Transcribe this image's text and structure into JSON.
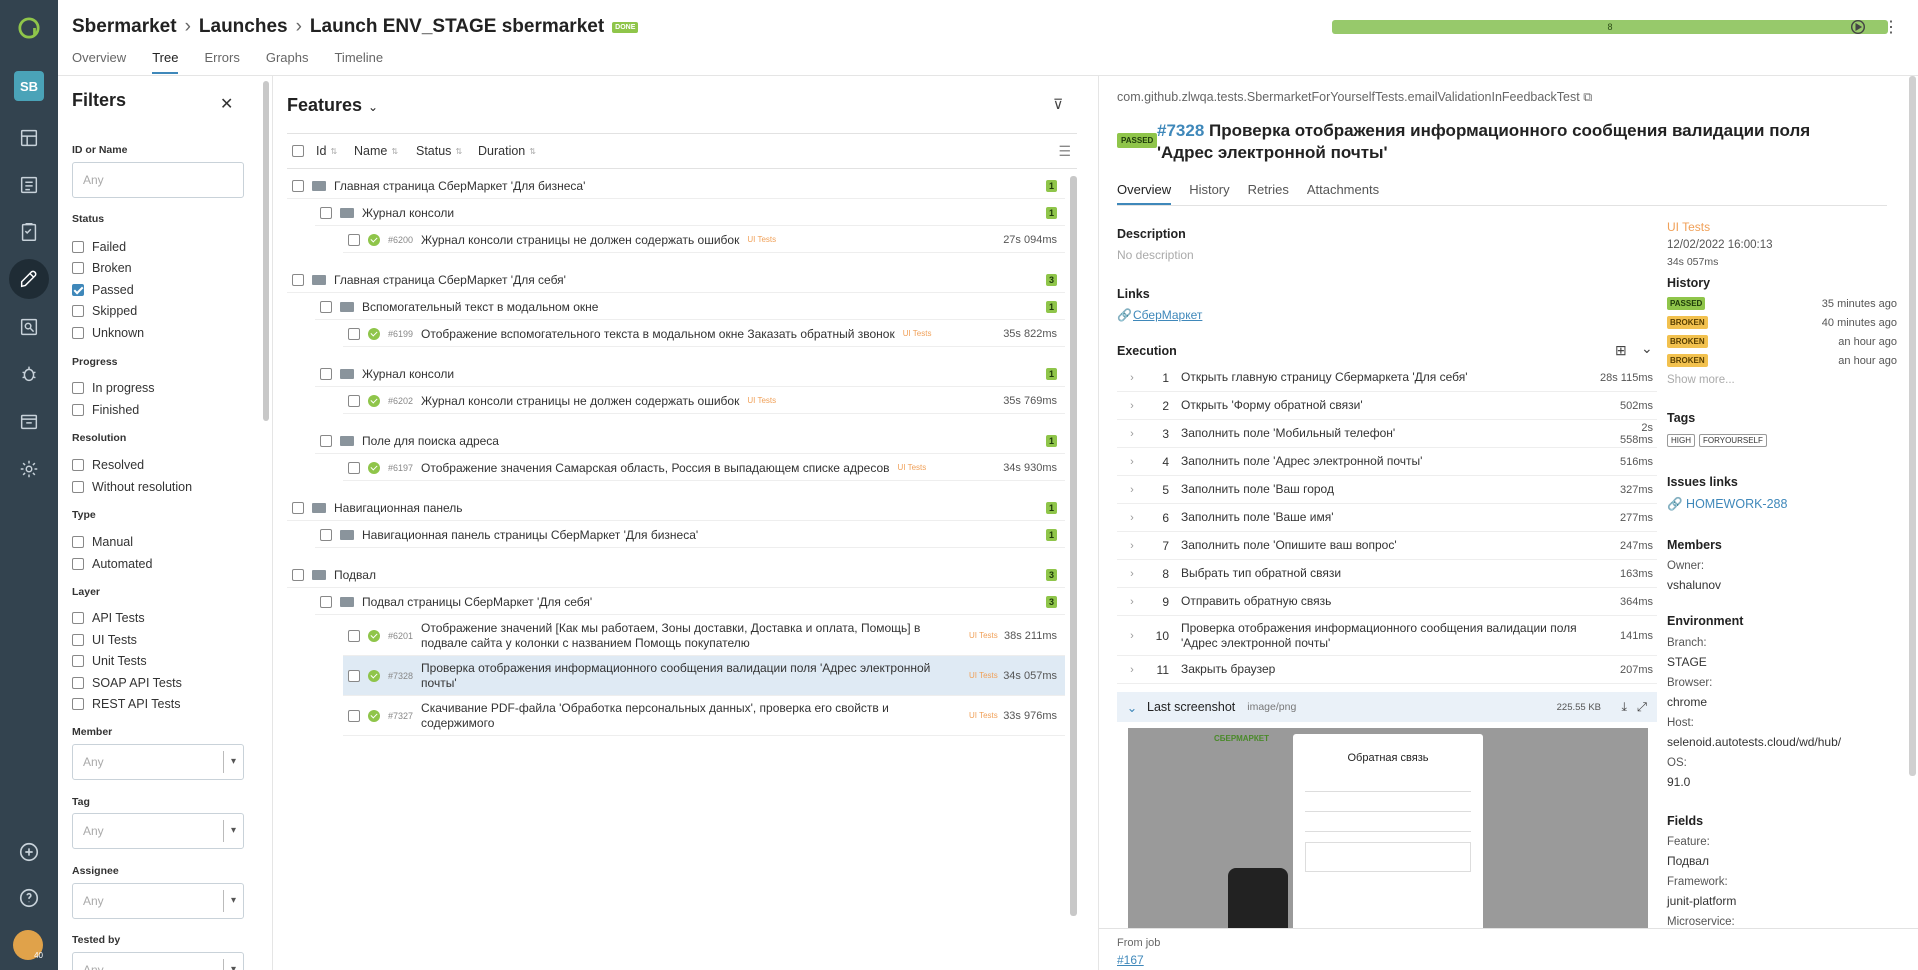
{
  "breadcrumb": {
    "project": "Sbermarket",
    "launches": "Launches",
    "launch": "Launch ENV_STAGE sbermarket",
    "status_badge": "DONE"
  },
  "top_tabs": [
    "Overview",
    "Tree",
    "Errors",
    "Graphs",
    "Timeline"
  ],
  "progress": {
    "label": "8",
    "fraction": 1.0,
    "color": "#97c96b"
  },
  "nav": {
    "avatar": "SB",
    "user_badge": "40"
  },
  "filters": {
    "title": "Filters",
    "id_label": "ID or Name",
    "id_placeholder": "Any",
    "status_label": "Status",
    "status": [
      {
        "label": "Failed",
        "checked": false
      },
      {
        "label": "Broken",
        "checked": false
      },
      {
        "label": "Passed",
        "checked": true
      },
      {
        "label": "Skipped",
        "checked": false
      },
      {
        "label": "Unknown",
        "checked": false
      }
    ],
    "progress_label": "Progress",
    "progress": [
      "In progress",
      "Finished"
    ],
    "resolution_label": "Resolution",
    "resolution": [
      "Resolved",
      "Without resolution"
    ],
    "type_label": "Type",
    "type": [
      "Manual",
      "Automated"
    ],
    "layer_label": "Layer",
    "layer": [
      "API Tests",
      "UI Tests",
      "Unit Tests",
      "SOAP API Tests",
      "REST API Tests"
    ],
    "member_label": "Member",
    "tag_label": "Tag",
    "assignee_label": "Assignee",
    "testedby_label": "Tested by",
    "select_placeholder": "Any"
  },
  "features": {
    "title": "Features",
    "columns": [
      "Id",
      "Name",
      "Status",
      "Duration"
    ],
    "rows": [
      {
        "name": "Главная страница СберМаркет 'Для бизнеса'",
        "count": "1"
      },
      {
        "name": "Журнал консоли",
        "count": "1"
      },
      {
        "id": "#6200",
        "name": "Журнал консоли страницы не должен содержать ошибок",
        "tag": "UI Tests",
        "duration": "27s 094ms"
      },
      {
        "name": "Главная страница СберМаркет 'Для себя'",
        "count": "3"
      },
      {
        "name": "Вспомогательный текст в модальном окне",
        "count": "1"
      },
      {
        "id": "#6199",
        "name": "Отображение вспомогательного текста в модальном окне Заказать обратный звонок",
        "tag": "UI Tests",
        "duration": "35s 822ms"
      },
      {
        "name": "Журнал консоли",
        "count": "1"
      },
      {
        "id": "#6202",
        "name": "Журнал консоли страницы не должен содержать ошибок",
        "tag": "UI Tests",
        "duration": "35s 769ms"
      },
      {
        "name": "Поле для поиска адреса",
        "count": "1"
      },
      {
        "id": "#6197",
        "name": "Отображение значения Самарская область, Россия в выпадающем списке адресов",
        "tag": "UI Tests",
        "duration": "34s 930ms"
      },
      {
        "name": "Навигационная панель",
        "count": "1"
      },
      {
        "name": "Навигационная панель страницы СберМаркет 'Для бизнеса'",
        "count": "1"
      },
      {
        "name": "Подвал",
        "count": "3"
      },
      {
        "name": "Подвал страницы СберМаркет 'Для себя'",
        "count": "3"
      },
      {
        "id": "#6201",
        "name": "Отображение значений [Как мы работаем, Зоны доставки, Доставка и оплата, Помощь] в подвале сайта у колонки с названием Помощь покупателю",
        "tag": "UI Tests",
        "duration": "38s 211ms"
      },
      {
        "id": "#7328",
        "name": "Проверка отображения информационного сообщения валидации поля 'Адрес электронной почты'",
        "tag": "UI Tests",
        "duration": "34s 057ms"
      },
      {
        "id": "#7327",
        "name": "Скачивание PDF-файла 'Обработка персональных данных', проверка его свойств и содержимого",
        "tag": "UI Tests",
        "duration": "33s 976ms"
      }
    ]
  },
  "detail": {
    "path": "com.github.zlwqa.tests.SbermarketForYourselfTests.emailValidationInFeedbackTest",
    "status": "PASSED",
    "number": "#7328",
    "title": "Проверка отображения информационного сообщения валидации поля 'Адрес электронной почты'",
    "tabs": [
      "Overview",
      "History",
      "Retries",
      "Attachments"
    ],
    "description_label": "Description",
    "description": "No description",
    "links_label": "Links",
    "link": "СберМаркет",
    "execution_label": "Execution",
    "steps": [
      {
        "n": "1",
        "text": "Открыть главную страницу Сбермаркета 'Для себя'",
        "d": "28s 115ms"
      },
      {
        "n": "2",
        "text": "Открыть 'Форму обратной связи'",
        "d": "502ms"
      },
      {
        "n": "3",
        "text": "Заполнить поле 'Мобильный телефон'",
        "d": "2s 558ms"
      },
      {
        "n": "4",
        "text": "Заполнить поле 'Адрес электронной почты'",
        "d": "516ms"
      },
      {
        "n": "5",
        "text": "Заполнить поле 'Ваш город",
        "d": "327ms"
      },
      {
        "n": "6",
        "text": "Заполнить поле 'Ваше имя'",
        "d": "277ms"
      },
      {
        "n": "7",
        "text": "Заполнить поле 'Опишите ваш вопрос'",
        "d": "247ms"
      },
      {
        "n": "8",
        "text": "Выбрать тип обратной связи",
        "d": "163ms"
      },
      {
        "n": "9",
        "text": "Отправить обратную связь",
        "d": "364ms"
      },
      {
        "n": "10",
        "text": "Проверка отображения информационного сообщения валидации поля 'Адрес электронной почты'",
        "d": "141ms"
      },
      {
        "n": "11",
        "text": "Закрыть браузер",
        "d": "207ms"
      }
    ],
    "screenshot": {
      "label": "Last screenshot",
      "type": "image/png",
      "size": "225.55 KB",
      "modal_title": "Обратная связь",
      "brand": "СБЕРМАРКЕТ"
    },
    "layer": "UI Tests",
    "date": "12/02/2022 16:00:13",
    "duration": "34s 057ms",
    "history_label": "History",
    "history": [
      {
        "status": "PASSED",
        "ago": "35 minutes ago"
      },
      {
        "status": "BROKEN",
        "ago": "40 minutes ago"
      },
      {
        "status": "BROKEN",
        "ago": "an hour ago"
      },
      {
        "status": "BROKEN",
        "ago": "an hour ago"
      }
    ],
    "show_more": "Show more...",
    "tags_label": "Tags",
    "tags": [
      "HIGH",
      "FORYOURSELF"
    ],
    "issues_label": "Issues links",
    "issue": "HOMEWORK-288",
    "members_label": "Members",
    "owner_label": "Owner:",
    "owner": "vshalunov",
    "env_label": "Environment",
    "env": [
      {
        "k": "Branch:",
        "v": "STAGE"
      },
      {
        "k": "Browser:",
        "v": "chrome"
      },
      {
        "k": "Host:",
        "v": "selenoid.autotests.cloud/wd/hub/"
      },
      {
        "k": "OS:",
        "v": "91.0"
      }
    ],
    "fields_label": "Fields",
    "fields": [
      {
        "k": "Feature:",
        "v": "Подвал"
      },
      {
        "k": "Framework:",
        "v": "junit-platform"
      },
      {
        "k": "Microservice:",
        "v": ""
      }
    ],
    "from_job_label": "From job",
    "from_job": "#167"
  }
}
